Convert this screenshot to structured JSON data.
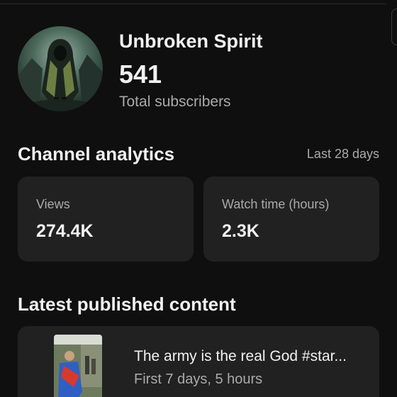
{
  "channel": {
    "name": "Unbroken Spirit",
    "subscriber_count": "541",
    "subscriber_label": "Total subscribers",
    "avatar_icon": "hooded-figure-avatar"
  },
  "analytics": {
    "title": "Channel analytics",
    "period": "Last 28 days",
    "metrics": [
      {
        "label": "Views",
        "value": "274.4K"
      },
      {
        "label": "Watch time (hours)",
        "value": "2.3K"
      }
    ]
  },
  "latest": {
    "title": "Latest published content",
    "video": {
      "title": "The army is the real God #star...",
      "stat": "First 7 days, 5 hours"
    }
  },
  "colors": {
    "background": "#0f0f0f",
    "card": "#212121",
    "text_primary": "#f1f1f1",
    "text_secondary": "#aaaaaa"
  }
}
